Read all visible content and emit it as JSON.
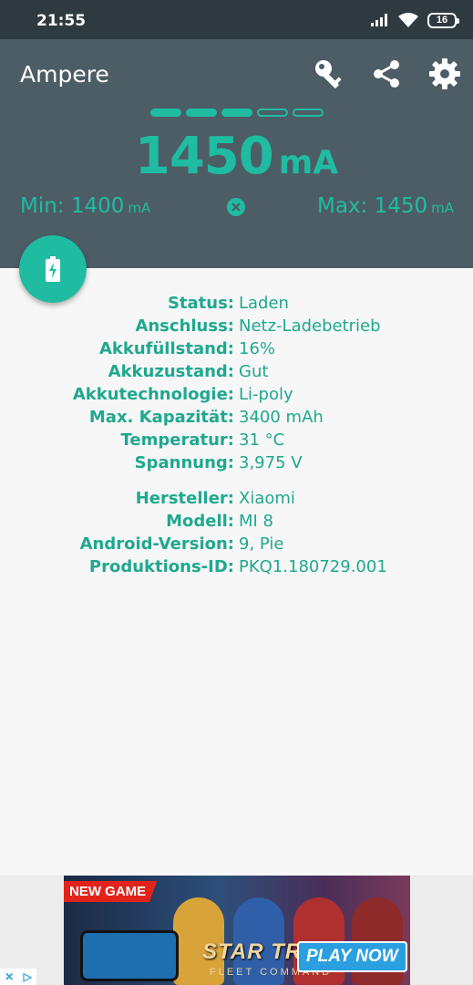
{
  "status_bar": {
    "time": "21:55",
    "battery_level": "16"
  },
  "header": {
    "title": "Ampere",
    "icons": [
      "key-icon",
      "share-icon",
      "gear-icon"
    ],
    "level_indicator": {
      "filled": 3,
      "total": 5
    },
    "current": {
      "value": "1450",
      "unit": "mA"
    },
    "min": {
      "label": "Min: 1400",
      "unit": "mA"
    },
    "max": {
      "label": "Max: 1450",
      "unit": "mA"
    },
    "accent_color": "#1fbca2",
    "background_color": "#4d5d65"
  },
  "battery_info": [
    {
      "label": "Status:",
      "value": "Laden"
    },
    {
      "label": "Anschluss:",
      "value": "Netz-Ladebetrieb"
    },
    {
      "label": "Akkufüllstand:",
      "value": "16%"
    },
    {
      "label": "Akkuzustand:",
      "value": "Gut"
    },
    {
      "label": "Akkutechnologie:",
      "value": "Li-poly"
    },
    {
      "label": "Max. Kapazität:",
      "value": "3400 mAh"
    },
    {
      "label": "Temperatur:",
      "value": "31 °C"
    },
    {
      "label": "Spannung:",
      "value": "3,975 V"
    }
  ],
  "device_info": [
    {
      "label": "Hersteller:",
      "value": "Xiaomi"
    },
    {
      "label": "Modell:",
      "value": "MI 8"
    },
    {
      "label": "Android-Version:",
      "value": "9, Pie"
    },
    {
      "label": "Produktions-ID:",
      "value": "PKQ1.180729.001"
    }
  ],
  "ad": {
    "badge": "NEW GAME",
    "game_title": "STAR TREK",
    "game_subtitle": "FLEET COMMAND",
    "cta": "PLAY NOW"
  }
}
